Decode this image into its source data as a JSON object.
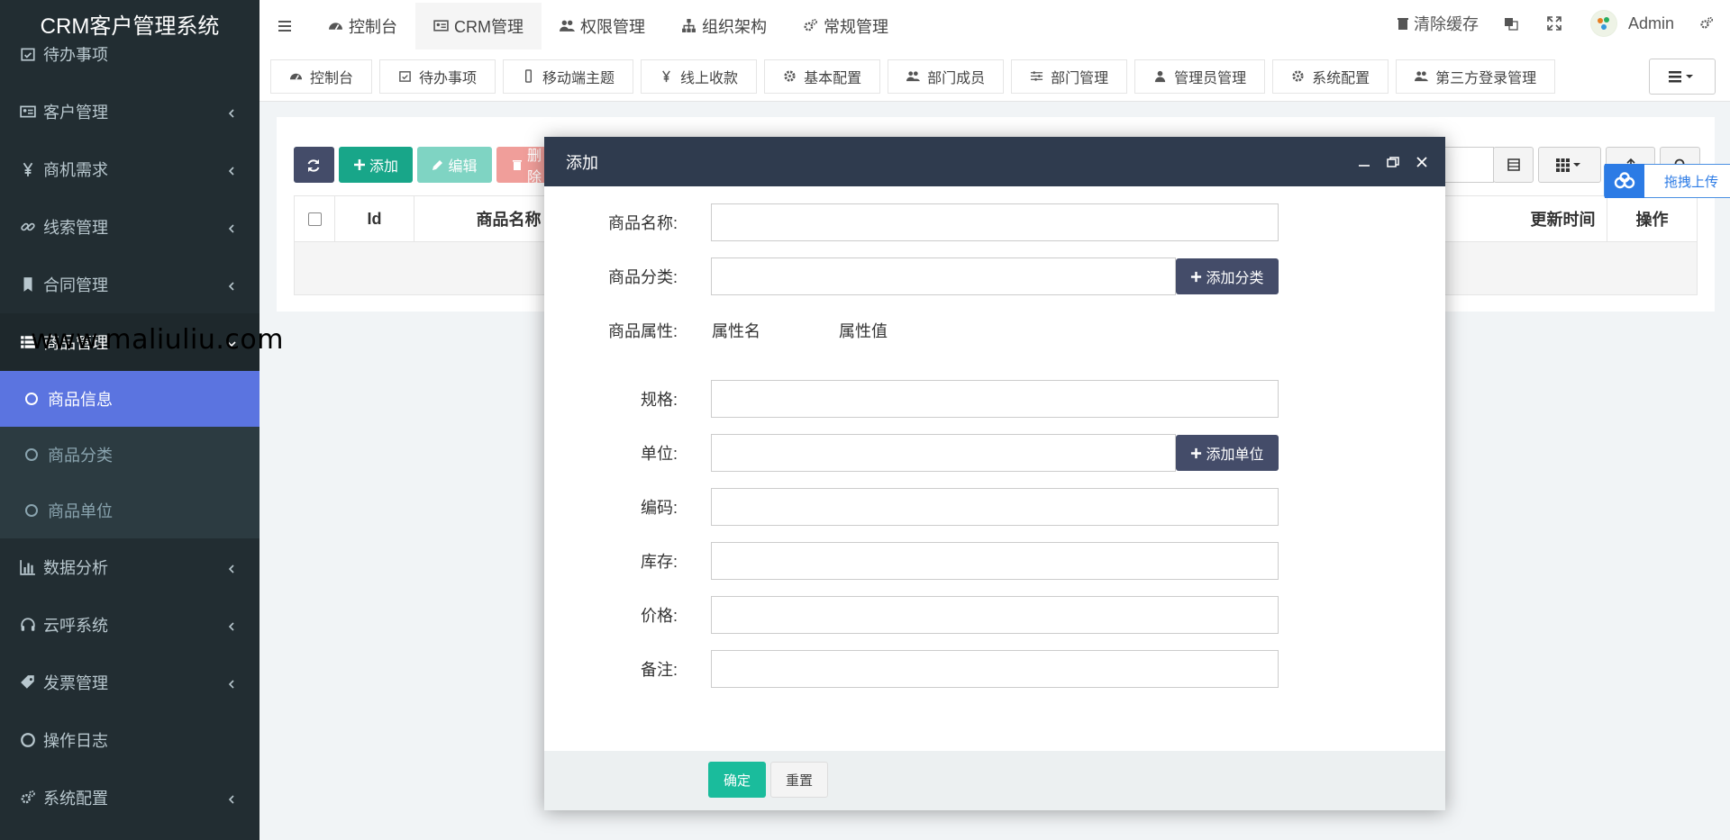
{
  "app": {
    "title": "CRM客户管理系统"
  },
  "watermark": "www.maliuliu.com",
  "sidebar": {
    "items": [
      {
        "label": "待办事项",
        "icon": "calendar-check-icon",
        "caret": false
      },
      {
        "label": "客户管理",
        "icon": "id-card-icon",
        "caret": true
      },
      {
        "label": "商机需求",
        "icon": "yen-icon",
        "caret": true
      },
      {
        "label": "线索管理",
        "icon": "link-icon",
        "caret": true
      },
      {
        "label": "合同管理",
        "icon": "bookmark-icon",
        "caret": true
      },
      {
        "label": "商品管理",
        "icon": "list-icon",
        "caret": true
      }
    ],
    "submenu": [
      {
        "label": "商品信息",
        "active": true
      },
      {
        "label": "商品分类",
        "active": false
      },
      {
        "label": "商品单位",
        "active": false
      }
    ],
    "items_after": [
      {
        "label": "数据分析",
        "icon": "bar-chart-icon",
        "caret": true
      },
      {
        "label": "云呼系统",
        "icon": "headphones-icon",
        "caret": true
      },
      {
        "label": "发票管理",
        "icon": "tag-icon",
        "caret": true
      },
      {
        "label": "操作日志",
        "icon": "circle-icon",
        "caret": false
      },
      {
        "label": "系统配置",
        "icon": "cogs-icon",
        "caret": true
      }
    ]
  },
  "topnav": {
    "items": [
      {
        "label": "控制台",
        "icon": "dashboard-icon"
      },
      {
        "label": "CRM管理",
        "icon": "id-card-icon"
      },
      {
        "label": "权限管理",
        "icon": "users-icon"
      },
      {
        "label": "组织架构",
        "icon": "sitemap-icon"
      },
      {
        "label": "常规管理",
        "icon": "cogs-icon"
      }
    ],
    "clear_cache": "清除缓存",
    "user": "Admin"
  },
  "tabs": [
    {
      "label": "控制台",
      "icon": "dashboard-icon"
    },
    {
      "label": "待办事项",
      "icon": "calendar-check-icon"
    },
    {
      "label": "移动端主题",
      "icon": "mobile-icon"
    },
    {
      "label": "线上收款",
      "icon": "yen-icon"
    },
    {
      "label": "基本配置",
      "icon": "gear-icon"
    },
    {
      "label": "部门成员",
      "icon": "users-icon"
    },
    {
      "label": "部门管理",
      "icon": "sliders-icon"
    },
    {
      "label": "管理员管理",
      "icon": "user-icon"
    },
    {
      "label": "系统配置",
      "icon": "gear-icon"
    },
    {
      "label": "第三方登录管理",
      "icon": "users-icon"
    }
  ],
  "toolbar": {
    "add": "添加",
    "edit": "编辑",
    "delete": "删除"
  },
  "table": {
    "headers": {
      "id": "Id",
      "name": "商品名称",
      "updated": "更新时间",
      "action": "操作"
    }
  },
  "upload": {
    "label": "拖拽上传"
  },
  "modal": {
    "title": "添加",
    "fields": {
      "name": "商品名称:",
      "category": "商品分类:",
      "attributes": "商品属性:",
      "spec": "规格:",
      "unit": "单位:",
      "code": "编码:",
      "stock": "库存:",
      "price": "价格:",
      "remark": "备注:"
    },
    "attr_name": "属性名",
    "attr_value": "属性值",
    "add_category": "添加分类",
    "add_unit": "添加单位",
    "confirm": "确定",
    "reset": "重置"
  }
}
